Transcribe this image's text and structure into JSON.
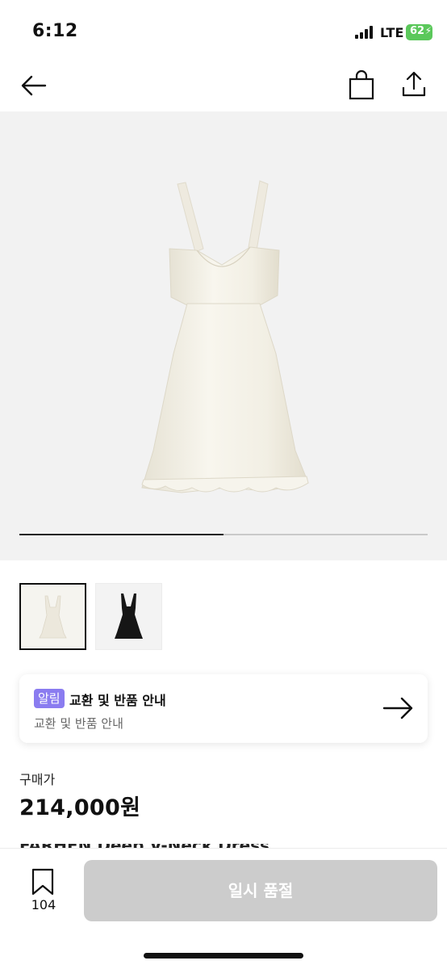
{
  "status_bar": {
    "time": "6:12",
    "carrier": "LTE",
    "battery": "62",
    "battery_color": "#5bc85b"
  },
  "nav": {
    "back_icon": "arrow-left-icon",
    "bag_icon": "shopping-bag-icon",
    "share_icon": "share-icon"
  },
  "gallery": {
    "progress_fraction": 0.5,
    "thumbnails": [
      {
        "name": "ivory dress",
        "selected": true,
        "color": "#ece8dc"
      },
      {
        "name": "black dress",
        "selected": false,
        "color": "#161616"
      }
    ]
  },
  "notice": {
    "badge": "알림",
    "title": "교환 및 반품 안내",
    "subtitle": "교환 및 반품 안내",
    "arrow_icon": "arrow-right-icon",
    "badge_color": "#8a7cf0"
  },
  "price": {
    "label": "구매가",
    "value": "214,000원"
  },
  "product": {
    "title_peek": "FARHEN Deep V-Neck Dress"
  },
  "bottom_bar": {
    "bookmark_icon": "bookmark-icon",
    "bookmark_count": "104",
    "button_label": "일시 품절",
    "button_color": "#cccccc"
  }
}
